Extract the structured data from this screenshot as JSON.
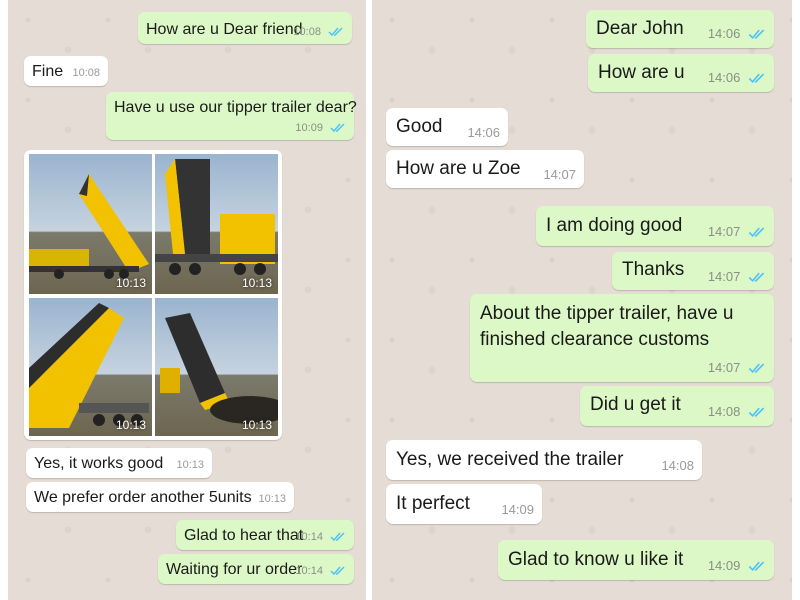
{
  "colors": {
    "outgoing": "#dcf8c6",
    "incoming": "#ffffff",
    "tick": "#4fc3f7",
    "wallpaper": "#e5ddd5"
  },
  "left_chat": {
    "messages": [
      {
        "text": "How are u Dear friend",
        "time": "10:08",
        "direction": "out",
        "ticks": true
      },
      {
        "text": "Fine",
        "time": "10:08",
        "direction": "in",
        "ticks": false
      },
      {
        "text": "Have u use our tipper trailer dear?",
        "time": "10:09",
        "direction": "out",
        "ticks": true
      },
      {
        "text": "Yes, it works good",
        "time": "10:13",
        "direction": "in",
        "ticks": false
      },
      {
        "text": "We prefer order another 5units",
        "time": "10:13",
        "direction": "in",
        "ticks": false
      },
      {
        "text": "Glad to hear that",
        "time": "10:14",
        "direction": "out",
        "ticks": true
      },
      {
        "text": "Waiting for ur order",
        "time": "10:14",
        "direction": "out",
        "ticks": true
      }
    ],
    "photos": [
      {
        "time": "10:13",
        "subject": "yellow tipper trailer raised"
      },
      {
        "time": "10:13",
        "subject": "yellow tipper trailer raised"
      },
      {
        "time": "10:13",
        "subject": "yellow tipper trailer raised"
      },
      {
        "time": "10:13",
        "subject": "yellow tipper trailer raised"
      }
    ]
  },
  "right_chat": {
    "messages": [
      {
        "text": "Dear John",
        "time": "14:06",
        "direction": "out",
        "ticks": true
      },
      {
        "text": "How are u",
        "time": "14:06",
        "direction": "out",
        "ticks": true
      },
      {
        "text": "Good",
        "time": "14:06",
        "direction": "in",
        "ticks": false
      },
      {
        "text": "How are u Zoe",
        "time": "14:07",
        "direction": "in",
        "ticks": false
      },
      {
        "text": "I am doing good",
        "time": "14:07",
        "direction": "out",
        "ticks": true
      },
      {
        "text": "Thanks",
        "time": "14:07",
        "direction": "out",
        "ticks": true
      },
      {
        "text_lines": [
          "About the tipper trailer, have u",
          "finished clearance customs"
        ],
        "time": "14:07",
        "direction": "out",
        "ticks": true
      },
      {
        "text": "Did u get it",
        "time": "14:08",
        "direction": "out",
        "ticks": true
      },
      {
        "text": "Yes, we received the trailer",
        "time": "14:08",
        "direction": "in",
        "ticks": false
      },
      {
        "text": "It perfect",
        "time": "14:09",
        "direction": "in",
        "ticks": false
      },
      {
        "text": "Glad to know u like it",
        "time": "14:09",
        "direction": "out",
        "ticks": true
      }
    ]
  }
}
